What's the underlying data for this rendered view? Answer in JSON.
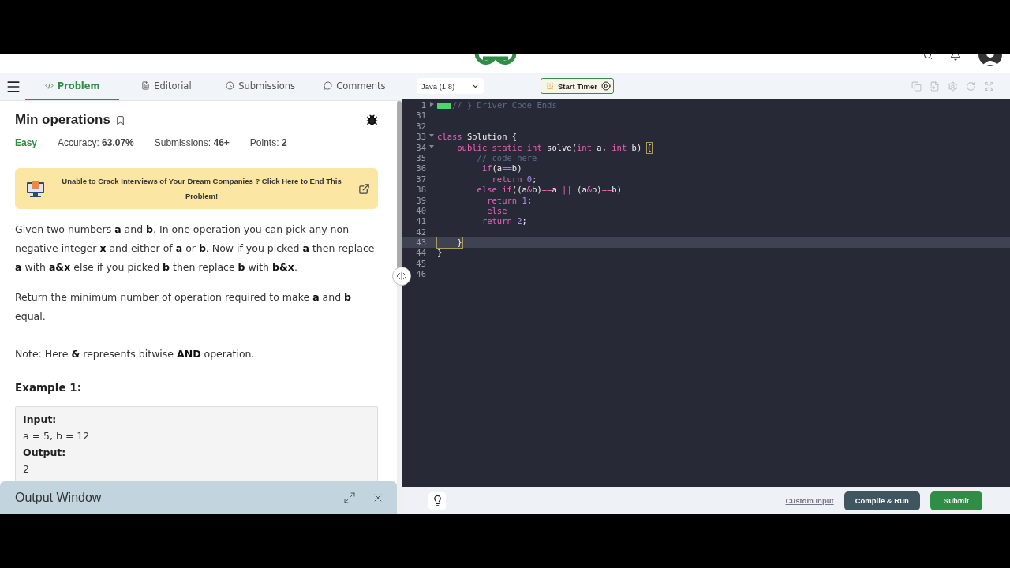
{
  "problem_tabs": [
    {
      "label": "Problem",
      "selected": true
    },
    {
      "label": "Editorial",
      "selected": false
    },
    {
      "label": "Submissions",
      "selected": false
    },
    {
      "label": "Comments",
      "selected": false
    }
  ],
  "problem": {
    "title": "Min operations",
    "difficulty": "Easy",
    "stats": [
      {
        "label": "Accuracy:",
        "value": "63.07%"
      },
      {
        "label": "Submissions:",
        "value": "46+"
      },
      {
        "label": "Points:",
        "value": "2"
      }
    ]
  },
  "banner": "Unable to Crack Interviews of Your Dream Companies ? Click Here to End This Problem!",
  "paragraphs": [
    "Given two numbers **a** and **b**. In one operation you can pick any non negative integer **x** and either of **a** or **b**. Now if you picked **a** then replace **a** with **a&x** else if you picked **b** then replace **b** with **b&x**.",
    "Return the minimum number of operation required to make **a** and **b** equal.",
    "Note: Here **&** represents bitwise **AND** operation."
  ],
  "example": {
    "heading": "Example 1:",
    "lines": [
      {
        "kind": "label",
        "text": "Input:"
      },
      {
        "kind": "value",
        "text": "a = 5, b = 12"
      },
      {
        "kind": "label",
        "text": "Output:"
      },
      {
        "kind": "value",
        "text": "2"
      }
    ]
  },
  "output_window": {
    "title": "Output Window"
  },
  "editor": {
    "language": "Java (1.8)",
    "timer_button": "Start Timer",
    "lines": [
      {
        "number": "1",
        "folded": true,
        "active": false,
        "tokens": [
          {
            "kind": "comment",
            "text": "// } Driver Code Ends"
          }
        ]
      },
      {
        "number": "31",
        "active": false
      },
      {
        "number": "32",
        "active": false
      },
      {
        "number": "33",
        "folded": false,
        "active": false,
        "tokens": [
          {
            "kind": "keyword",
            "text": "class"
          },
          {
            "kind": "plain",
            "text": " Solution {"
          }
        ]
      },
      {
        "number": "34",
        "folded": false,
        "active": false,
        "tokens": [
          {
            "kind": "keyword",
            "text": "    public static int"
          },
          {
            "kind": "plain",
            "text": " solve("
          },
          {
            "kind": "keyword",
            "text": "int"
          },
          {
            "kind": "plain",
            "text": " a, "
          },
          {
            "kind": "keyword",
            "text": "int"
          },
          {
            "kind": "plain",
            "text": " b) "
          },
          {
            "kind": "match",
            "text": "{"
          }
        ]
      },
      {
        "number": "35",
        "active": false,
        "tokens": [
          {
            "kind": "comment",
            "text": "        // code here"
          }
        ]
      },
      {
        "number": "36",
        "active": false,
        "tokens": [
          {
            "kind": "keyword",
            "text": "         if"
          },
          {
            "kind": "plain",
            "text": "(a"
          },
          {
            "kind": "operator",
            "text": "=="
          },
          {
            "kind": "plain",
            "text": "b)"
          }
        ]
      },
      {
        "number": "37",
        "active": false,
        "tokens": [
          {
            "kind": "keyword",
            "text": "           return "
          },
          {
            "kind": "number",
            "text": "0"
          },
          {
            "kind": "plain",
            "text": ";"
          }
        ]
      },
      {
        "number": "38",
        "active": false,
        "tokens": [
          {
            "kind": "keyword",
            "text": "        else if"
          },
          {
            "kind": "plain",
            "text": "((a"
          },
          {
            "kind": "operator",
            "text": "&"
          },
          {
            "kind": "plain",
            "text": "b)"
          },
          {
            "kind": "operator",
            "text": "=="
          },
          {
            "kind": "plain",
            "text": "a "
          },
          {
            "kind": "operator",
            "text": "||"
          },
          {
            "kind": "plain",
            "text": " (a"
          },
          {
            "kind": "operator",
            "text": "&"
          },
          {
            "kind": "plain",
            "text": "b)"
          },
          {
            "kind": "operator",
            "text": "=="
          },
          {
            "kind": "plain",
            "text": "b)"
          }
        ]
      },
      {
        "number": "39",
        "active": false,
        "tokens": [
          {
            "kind": "keyword",
            "text": "          return "
          },
          {
            "kind": "number",
            "text": "1"
          },
          {
            "kind": "plain",
            "text": ";"
          }
        ]
      },
      {
        "number": "40",
        "active": false,
        "tokens": [
          {
            "kind": "keyword",
            "text": "          else"
          }
        ]
      },
      {
        "number": "41",
        "active": false,
        "tokens": [
          {
            "kind": "keyword",
            "text": "         return "
          },
          {
            "kind": "number",
            "text": "2"
          },
          {
            "kind": "plain",
            "text": ";"
          }
        ]
      },
      {
        "number": "42",
        "active": false
      },
      {
        "number": "43",
        "active": true,
        "tokens": [
          {
            "kind": "match",
            "text": "    }"
          }
        ]
      },
      {
        "number": "44",
        "active": false,
        "tokens": [
          {
            "kind": "plain",
            "text": "}"
          }
        ]
      },
      {
        "number": "45",
        "active": false
      },
      {
        "number": "46",
        "active": false
      }
    ]
  },
  "footer": {
    "custom_input": "Custom Input",
    "compile_button": "Compile & Run",
    "submit_button": "Submit"
  }
}
